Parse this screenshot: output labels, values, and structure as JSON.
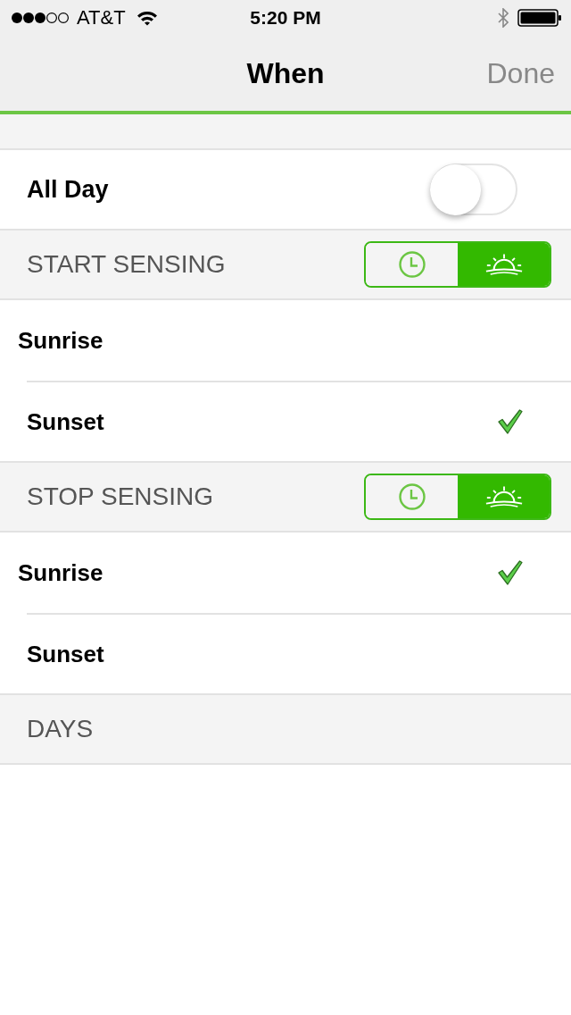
{
  "status_bar": {
    "carrier": "AT&T",
    "time": "5:20 PM"
  },
  "nav": {
    "title": "When",
    "done": {
      "label": "Done",
      "disabled": true
    }
  },
  "all_day": {
    "label": "All Day",
    "on": false
  },
  "sections": [
    {
      "title": "START SENSING",
      "modes": [
        {
          "kind": "clock",
          "selected": false
        },
        {
          "kind": "sun",
          "selected": true
        }
      ],
      "options": [
        {
          "label": "Sunrise",
          "checked": false
        },
        {
          "label": "Sunset",
          "checked": true
        }
      ]
    },
    {
      "title": "STOP SENSING",
      "modes": [
        {
          "kind": "clock",
          "selected": false
        },
        {
          "kind": "sun",
          "selected": true
        }
      ],
      "options": [
        {
          "label": "Sunrise",
          "checked": true
        },
        {
          "label": "Sunset",
          "checked": false
        }
      ]
    },
    {
      "title": "DAYS"
    }
  ]
}
